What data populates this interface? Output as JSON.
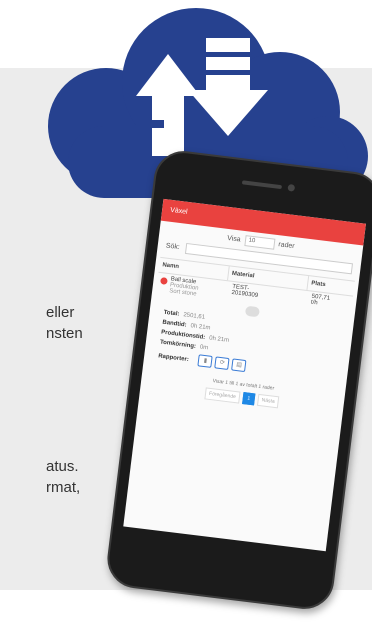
{
  "colors": {
    "cloud": "#26418f",
    "accent_red": "#e9423f",
    "accent_blue": "#1e88e5",
    "panel": "#ececec"
  },
  "background_text": {
    "fragment_1": [
      "eller",
      "nsten"
    ],
    "fragment_2": [
      "atus.",
      "rmat,"
    ]
  },
  "app": {
    "title": "Växel",
    "show_prefix": "Visa",
    "page_size": "10",
    "show_suffix": "rader",
    "search_label": "Sök:",
    "columns": [
      "Namn",
      "Material",
      "Plats"
    ],
    "row": {
      "name": "Ball scale",
      "sub1": "Produktion",
      "sub2": "Sort stone",
      "material_1": "TEST-",
      "material_2": "20190309",
      "plats_1": "507,71",
      "plats_2": "t/h"
    },
    "details": [
      {
        "label": "Total:",
        "value": "2501,61"
      },
      {
        "label": "Bandtid:",
        "value": "0h 21m"
      },
      {
        "label": "Produktionstid:",
        "value": "0h 21m"
      },
      {
        "label": "Tomkörning:",
        "value": "0m"
      }
    ],
    "reports_label": "Rapporter:",
    "footer_text": "Visar 1 till 1 av totalt 1 rader",
    "pager": {
      "prev": "Föregående",
      "current": "1",
      "next": "Nästa"
    }
  },
  "icons": [
    "cloud-upload-download-icon",
    "bar-chart-icon",
    "refresh-icon",
    "document-icon"
  ]
}
